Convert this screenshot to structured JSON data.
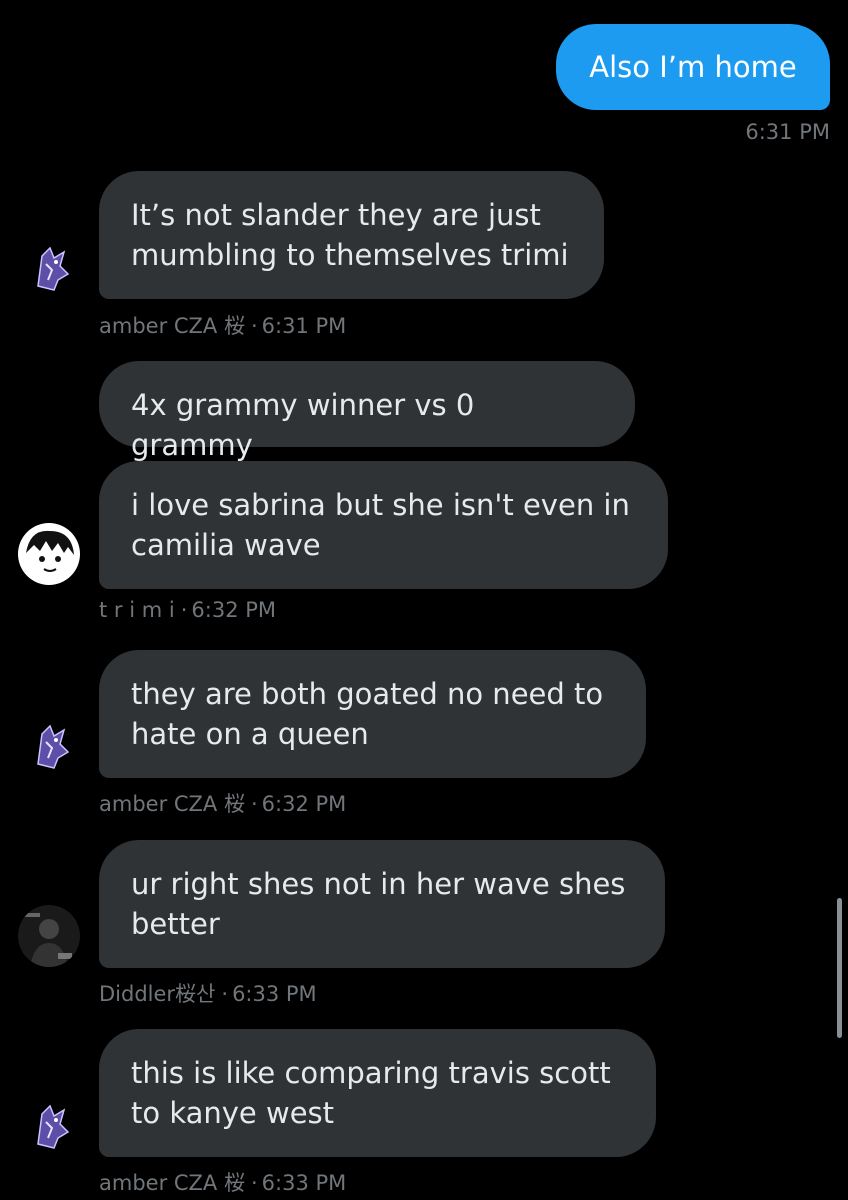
{
  "sent": {
    "text": "Also I’m home",
    "time": "6:31 PM"
  },
  "messages": [
    {
      "text": "It’s not slander they are just mumbling to themselves trimi",
      "sender": "amber CZA 桜",
      "time": "6:31 PM"
    },
    {
      "text": "4x grammy winner vs 0 grammy"
    },
    {
      "text": "i love sabrina but she isn't even in camilia wave",
      "sender": "t r i m i",
      "time": "6:32 PM"
    },
    {
      "text": "they are both goated no need to hate on a queen",
      "sender": "amber CZA 桜",
      "time": "6:32 PM"
    },
    {
      "text": "ur right shes not in her wave shes better",
      "sender": "Diddler桜산",
      "time": "6:33 PM"
    },
    {
      "text": "this is like comparing travis scott to kanye west",
      "sender": "amber CZA 桜",
      "time": "6:33 PM"
    }
  ],
  "separator": "·",
  "colors": {
    "incoming_bubble": "#2f3336",
    "outgoing_bubble": "#1d9bf0",
    "meta_text": "#71767b",
    "background": "#000000"
  },
  "icons": {
    "avatar_amber": "dragon-avatar-icon",
    "avatar_trimi": "anime-avatar-icon",
    "avatar_diddler": "dark-photo-avatar-icon"
  }
}
